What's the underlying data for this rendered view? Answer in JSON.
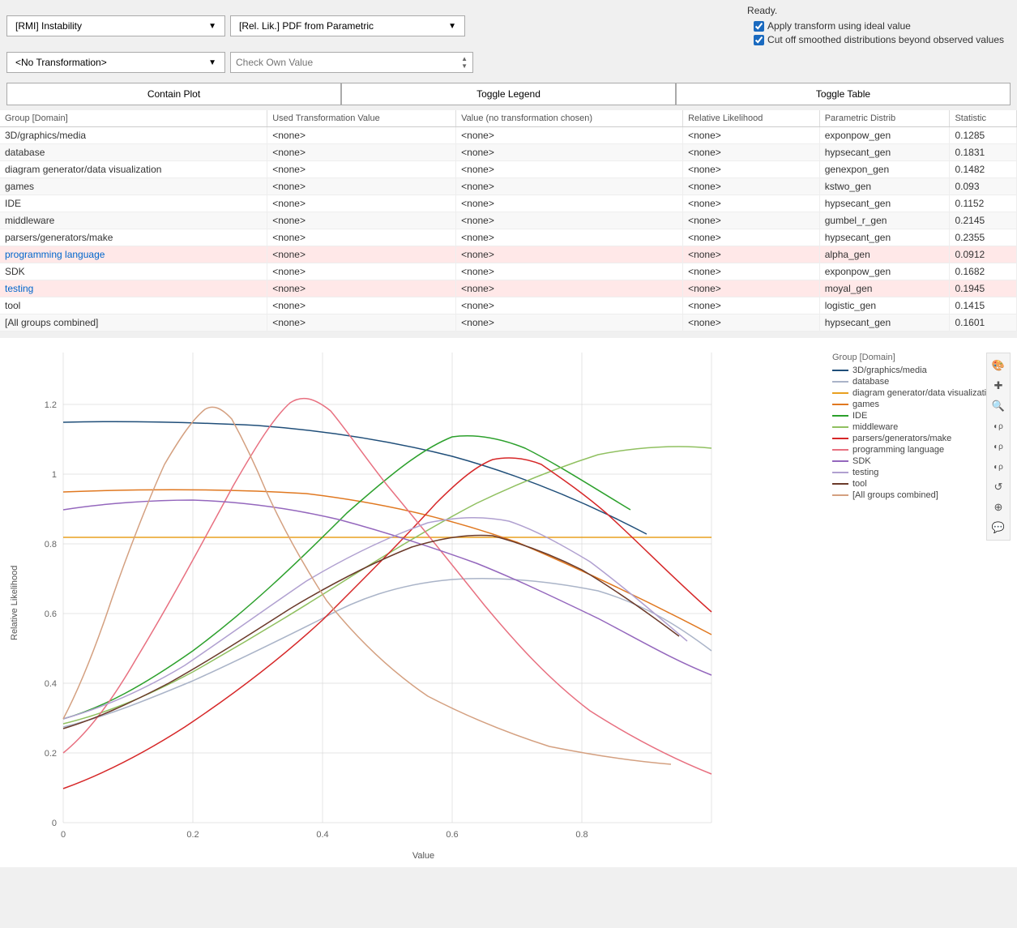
{
  "status": "Ready.",
  "controls": {
    "instability_label": "[RMI] Instability",
    "pdf_label": "[Rel. Lik.] PDF from Parametric",
    "no_transform_label": "<No Transformation>",
    "check_own_value_placeholder": "Check Own Value",
    "apply_transform_label": "Apply transform using ideal value",
    "cut_off_label": "Cut off smoothed distributions beyond observed values"
  },
  "action_buttons": {
    "contain_plot": "Contain Plot",
    "toggle_legend": "Toggle Legend",
    "toggle_table": "Toggle Table"
  },
  "table": {
    "headers": [
      "Group [Domain]",
      "Used Transformation Value",
      "Value (no transformation chosen)",
      "Relative Likelihood",
      "Parametric Distrib",
      "Statistic"
    ],
    "rows": [
      {
        "group": "3D/graphics/media",
        "trans": "<none>",
        "value": "<none>",
        "rel": "<none>",
        "param": "exponpow_gen",
        "stat": "0.1285",
        "highlight": false
      },
      {
        "group": "database",
        "trans": "<none>",
        "value": "<none>",
        "rel": "<none>",
        "param": "hypsecant_gen",
        "stat": "0.1831",
        "highlight": false
      },
      {
        "group": "diagram generator/data visualization",
        "trans": "<none>",
        "value": "<none>",
        "rel": "<none>",
        "param": "genexpon_gen",
        "stat": "0.1482",
        "highlight": false
      },
      {
        "group": "games",
        "trans": "<none>",
        "value": "<none>",
        "rel": "<none>",
        "param": "kstwo_gen",
        "stat": "0.093",
        "highlight": false
      },
      {
        "group": "IDE",
        "trans": "<none>",
        "value": "<none>",
        "rel": "<none>",
        "param": "hypsecant_gen",
        "stat": "0.1152",
        "highlight": false
      },
      {
        "group": "middleware",
        "trans": "<none>",
        "value": "<none>",
        "rel": "<none>",
        "param": "gumbel_r_gen",
        "stat": "0.2145",
        "highlight": false
      },
      {
        "group": "parsers/generators/make",
        "trans": "<none>",
        "value": "<none>",
        "rel": "<none>",
        "param": "hypsecant_gen",
        "stat": "0.2355",
        "highlight": false
      },
      {
        "group": "programming language",
        "trans": "<none>",
        "value": "<none>",
        "rel": "<none>",
        "param": "alpha_gen",
        "stat": "0.0912",
        "highlight": true
      },
      {
        "group": "SDK",
        "trans": "<none>",
        "value": "<none>",
        "rel": "<none>",
        "param": "exponpow_gen",
        "stat": "0.1682",
        "highlight": false
      },
      {
        "group": "testing",
        "trans": "<none>",
        "value": "<none>",
        "rel": "<none>",
        "param": "moyal_gen",
        "stat": "0.1945",
        "highlight": true
      },
      {
        "group": "tool",
        "trans": "<none>",
        "value": "<none>",
        "rel": "<none>",
        "param": "logistic_gen",
        "stat": "0.1415",
        "highlight": false
      },
      {
        "group": "[All groups combined]",
        "trans": "<none>",
        "value": "<none>",
        "rel": "<none>",
        "param": "hypsecant_gen",
        "stat": "0.1601",
        "highlight": false
      }
    ]
  },
  "chart": {
    "y_label": "Relative Likelihood",
    "x_label": "Value",
    "y_ticks": [
      "0",
      "0.2",
      "0.4",
      "0.6",
      "0.8",
      "1",
      "1.2"
    ],
    "x_ticks": [
      "0",
      "0.2",
      "0.4",
      "0.6",
      "0.8"
    ]
  },
  "legend": {
    "title": "Group [Domain]",
    "items": [
      {
        "label": "3D/graphics/media",
        "color": "#1f4e79"
      },
      {
        "label": "database",
        "color": "#aab4c8"
      },
      {
        "label": "diagram generator/data visualization",
        "color": "#e8a020"
      },
      {
        "label": "games",
        "color": "#e07820"
      },
      {
        "label": "IDE",
        "color": "#2ca02c"
      },
      {
        "label": "middleware",
        "color": "#90c060"
      },
      {
        "label": "parsers/generators/make",
        "color": "#d62728"
      },
      {
        "label": "programming language",
        "color": "#e87080"
      },
      {
        "label": "SDK",
        "color": "#9467bd"
      },
      {
        "label": "testing",
        "color": "#b0a0d0"
      },
      {
        "label": "tool",
        "color": "#6b3a2a"
      },
      {
        "label": "[All groups combined]",
        "color": "#d4a080"
      }
    ]
  },
  "toolbar": {
    "tools": [
      "🎨",
      "✚",
      "🔍",
      "◐ρ",
      "◐ρ",
      "◐ρ",
      "↺",
      "⊕",
      "💬"
    ]
  }
}
